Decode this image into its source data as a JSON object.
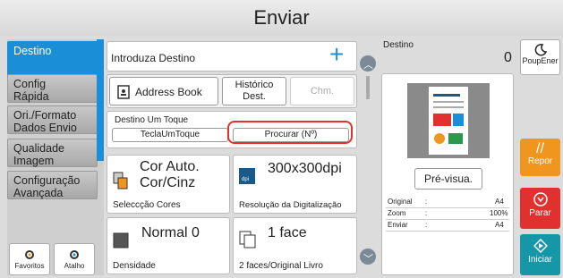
{
  "title": "Enviar",
  "left_tabs": [
    {
      "label": "Destino",
      "active": true
    },
    {
      "label": "Config\nRápida",
      "active": false
    },
    {
      "label": "Ori./Formato\nDados Envio",
      "active": false
    },
    {
      "label": "Qualidade\nImagem",
      "active": false
    },
    {
      "label": "Configuração\nAvançada",
      "active": false
    }
  ],
  "favoritos": "Favoritos",
  "atalho": "Atalho",
  "dest_input": "Introduza Destino",
  "address_book": "Address Book",
  "historico": "Histórico\nDest.",
  "chm": "Chm.",
  "one_touch_label": "Destino Um Toque",
  "tecla": "TeclaUmToque",
  "procurar": "Procurar (Nº)",
  "color_value": "Cor Auto.\nCor/Cinz",
  "color_caption": "Seleccção Cores",
  "res_value": "300x300dpi",
  "res_caption": "Resolução da Digitalização",
  "density_value": "Normal 0",
  "density_caption": "Densidade",
  "duplex_value": "1 face",
  "duplex_caption": "2 faces/Original Livro",
  "dest_label": "Destino",
  "dest_count": "0",
  "preview_btn": "Pré-visua.",
  "info": [
    {
      "k": "Original",
      "v": "A4"
    },
    {
      "k": "Zoom",
      "v": "100%"
    },
    {
      "k": "Enviar",
      "v": "A4"
    }
  ],
  "poupener": "PoupEner",
  "repor": "Repor",
  "parar": "Parar",
  "iniciar": "Iniciar",
  "colors": {
    "blue": "#1a8fd8",
    "orange": "#f0961e",
    "red": "#e0312e",
    "teal": "#1597a8"
  }
}
